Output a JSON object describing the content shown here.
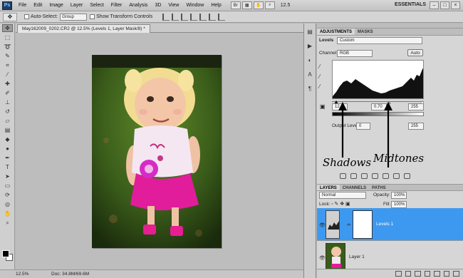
{
  "menubar": {
    "logo": "Ps",
    "items": [
      "File",
      "Edit",
      "Image",
      "Layer",
      "Select",
      "Filter",
      "Analysis",
      "3D",
      "View",
      "Window",
      "Help"
    ],
    "zoom": "12.5",
    "workspace": "ESSENTIALS",
    "window_controls": [
      "–",
      "□",
      "×"
    ]
  },
  "options_bar": {
    "auto_select_label": "Auto-Select:",
    "auto_select_value": "Group",
    "transform_label": "Show Transform Controls"
  },
  "document": {
    "tab_title": "May162009_0202.CR2 @ 12.5% (Levels 1, Layer Mask/8) *"
  },
  "status": {
    "zoom": "12.5%",
    "doc": "Doc: 34.8M/69.6M"
  },
  "adjustments": {
    "tabs": [
      "ADJUSTMENTS",
      "MASKS"
    ],
    "title": "Levels",
    "preset": "Custom",
    "channel_label": "Channel:",
    "channel_value": "RGB",
    "auto_label": "Auto",
    "input_shadow": "12",
    "input_mid": "0.70",
    "input_high": "255",
    "output_label": "Output Levels:",
    "output_low": "0",
    "output_high": "255"
  },
  "annotations": {
    "shadows": "Shadows",
    "midtones": "Midtones"
  },
  "layers": {
    "tabs": [
      "LAYERS",
      "CHANNELS",
      "PATHS"
    ],
    "blend_mode": "Normal",
    "opacity_label": "Opacity:",
    "opacity_value": "100%",
    "lock_label": "Lock:",
    "fill_label": "Fill:",
    "fill_value": "100%",
    "items": [
      {
        "name": "Levels 1"
      },
      {
        "name": "Layer 1"
      }
    ]
  },
  "colors": {
    "selection": "#3d99f0",
    "accent": "#1e3f66"
  }
}
